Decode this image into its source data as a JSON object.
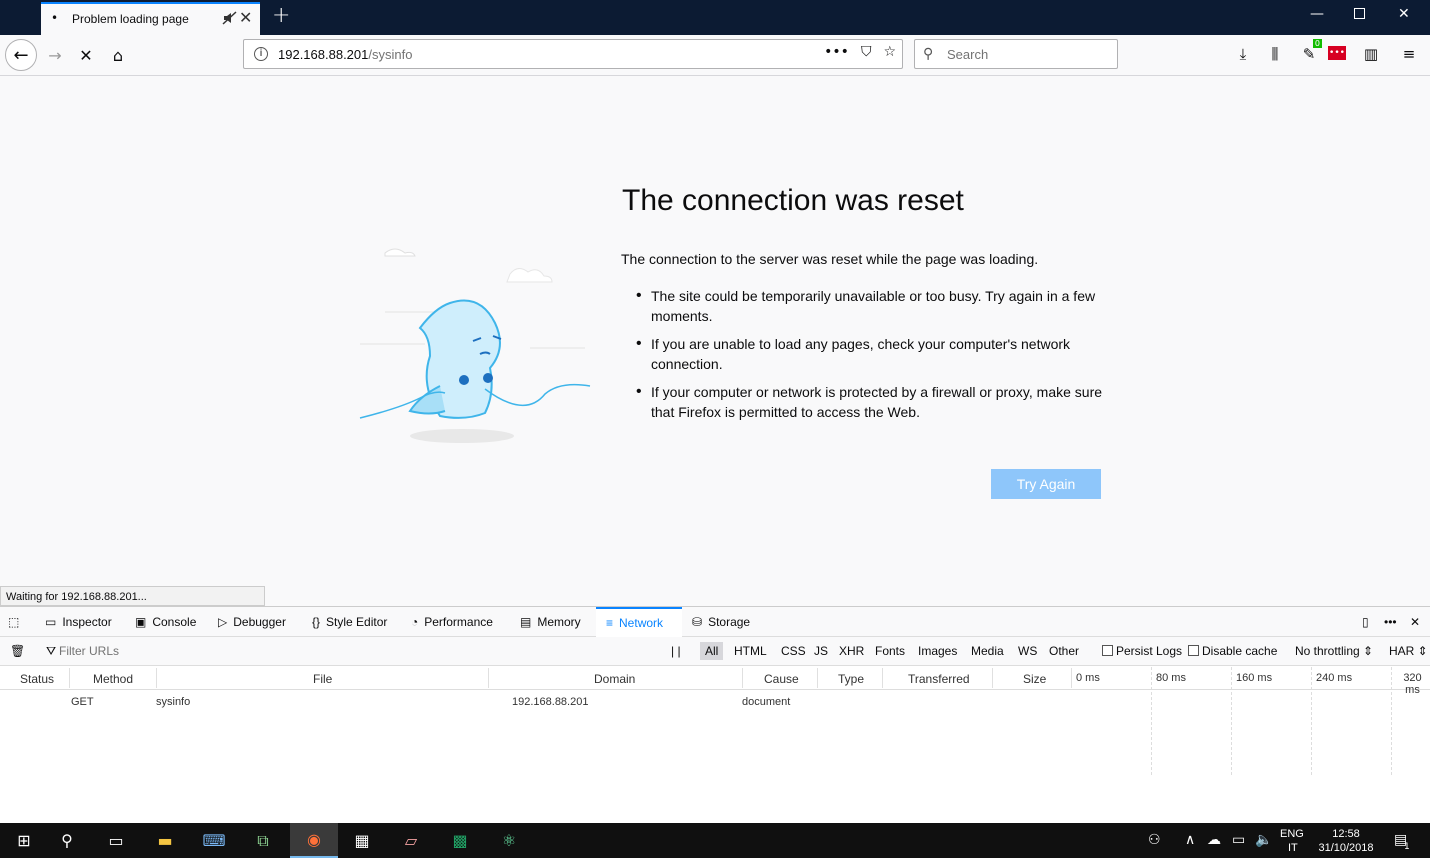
{
  "browser": {
    "tab_title": "Problem loading page",
    "new_tab_label": "+",
    "url_host": "192.168.88.201",
    "url_path": "/sysinfo",
    "search_placeholder": "Search",
    "toolbar_badge": "0"
  },
  "error_page": {
    "title": "The connection was reset",
    "description": "The connection to the server was reset while the page was loading.",
    "items": [
      "The site could be temporarily unavailable or too busy. Try again in a few moments.",
      "If you are unable to load any pages, check your computer's network connection.",
      "If your computer or network is protected by a firewall or proxy, make sure that Firefox is permitted to access the Web."
    ],
    "button_label": "Try Again"
  },
  "status_text": "Waiting for 192.168.88.201...",
  "devtools": {
    "tabs": [
      "Inspector",
      "Console",
      "Debugger",
      "Style Editor",
      "Performance",
      "Memory",
      "Network",
      "Storage"
    ],
    "selected_tab": "Network",
    "filter_placeholder": "Filter URLs",
    "pause_label": "| |",
    "type_filters": [
      "All",
      "HTML",
      "CSS",
      "JS",
      "XHR",
      "Fonts",
      "Images",
      "Media",
      "WS",
      "Other"
    ],
    "persist_logs": "Persist Logs",
    "disable_cache": "Disable cache",
    "throttling": "No throttling",
    "har": "HAR",
    "columns": [
      "Status",
      "Method",
      "File",
      "Domain",
      "Cause",
      "Type",
      "Transferred",
      "Size"
    ],
    "timeline_ticks": [
      "0 ms",
      "80 ms",
      "160 ms",
      "240 ms",
      "320 ms"
    ],
    "requests": [
      {
        "status": "",
        "method": "GET",
        "file": "sysinfo",
        "domain": "192.168.88.201",
        "cause": "document",
        "type": "",
        "transferred": "",
        "size": ""
      }
    ]
  },
  "taskbar": {
    "lang_top": "ENG",
    "lang_bottom": "IT",
    "time": "12:58",
    "date": "31/10/2018",
    "notification_count": "1"
  },
  "colors": {
    "accent": "#0a84ff",
    "button": "#8ec6fa",
    "titlebar": "#0c1b33",
    "taskbar": "#101010"
  }
}
